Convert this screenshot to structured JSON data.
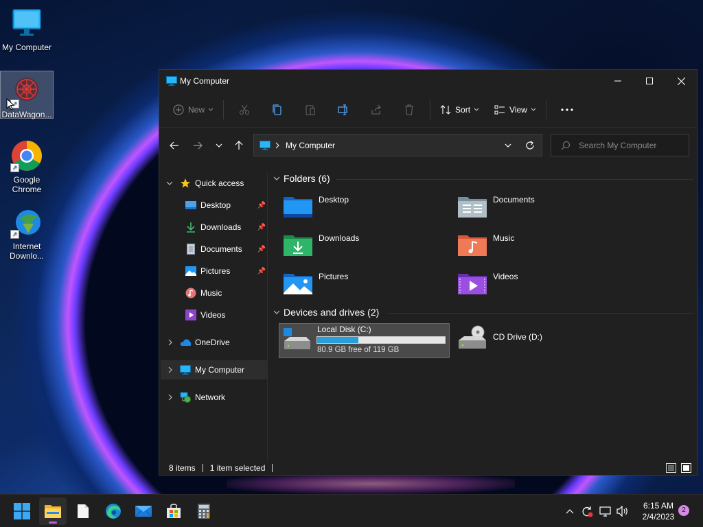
{
  "desktop": {
    "icons": [
      {
        "label": "My Computer"
      },
      {
        "label": "DataWagon..."
      },
      {
        "label": "Google Chrome"
      },
      {
        "label": "Internet Downlo..."
      }
    ]
  },
  "window": {
    "title": "My Computer",
    "toolbar": {
      "new_label": "New",
      "sort_label": "Sort",
      "view_label": "View"
    },
    "address": {
      "path": "My Computer",
      "search_placeholder": "Search My Computer"
    },
    "nav": {
      "quick_access": "Quick access",
      "quick_items": [
        {
          "label": "Desktop",
          "pinned": true
        },
        {
          "label": "Downloads",
          "pinned": true
        },
        {
          "label": "Documents",
          "pinned": true
        },
        {
          "label": "Pictures",
          "pinned": true
        },
        {
          "label": "Music",
          "pinned": false
        },
        {
          "label": "Videos",
          "pinned": false
        }
      ],
      "onedrive": "OneDrive",
      "this_pc": "My Computer",
      "network": "Network"
    },
    "content": {
      "folders_header": "Folders (6)",
      "folders": [
        {
          "name": "Desktop"
        },
        {
          "name": "Documents"
        },
        {
          "name": "Downloads"
        },
        {
          "name": "Music"
        },
        {
          "name": "Pictures"
        },
        {
          "name": "Videos"
        }
      ],
      "drives_header": "Devices and drives (2)",
      "drives": [
        {
          "name": "Local Disk (C:)",
          "free_text": "80.9 GB free of 119 GB",
          "used_fraction": 0.32
        },
        {
          "name": "CD Drive (D:)"
        }
      ]
    },
    "status": {
      "items": "8 items",
      "selected": "1 item selected"
    }
  },
  "taskbar": {
    "time": "6:15 AM",
    "date": "2/4/2023",
    "notifications": "2"
  }
}
